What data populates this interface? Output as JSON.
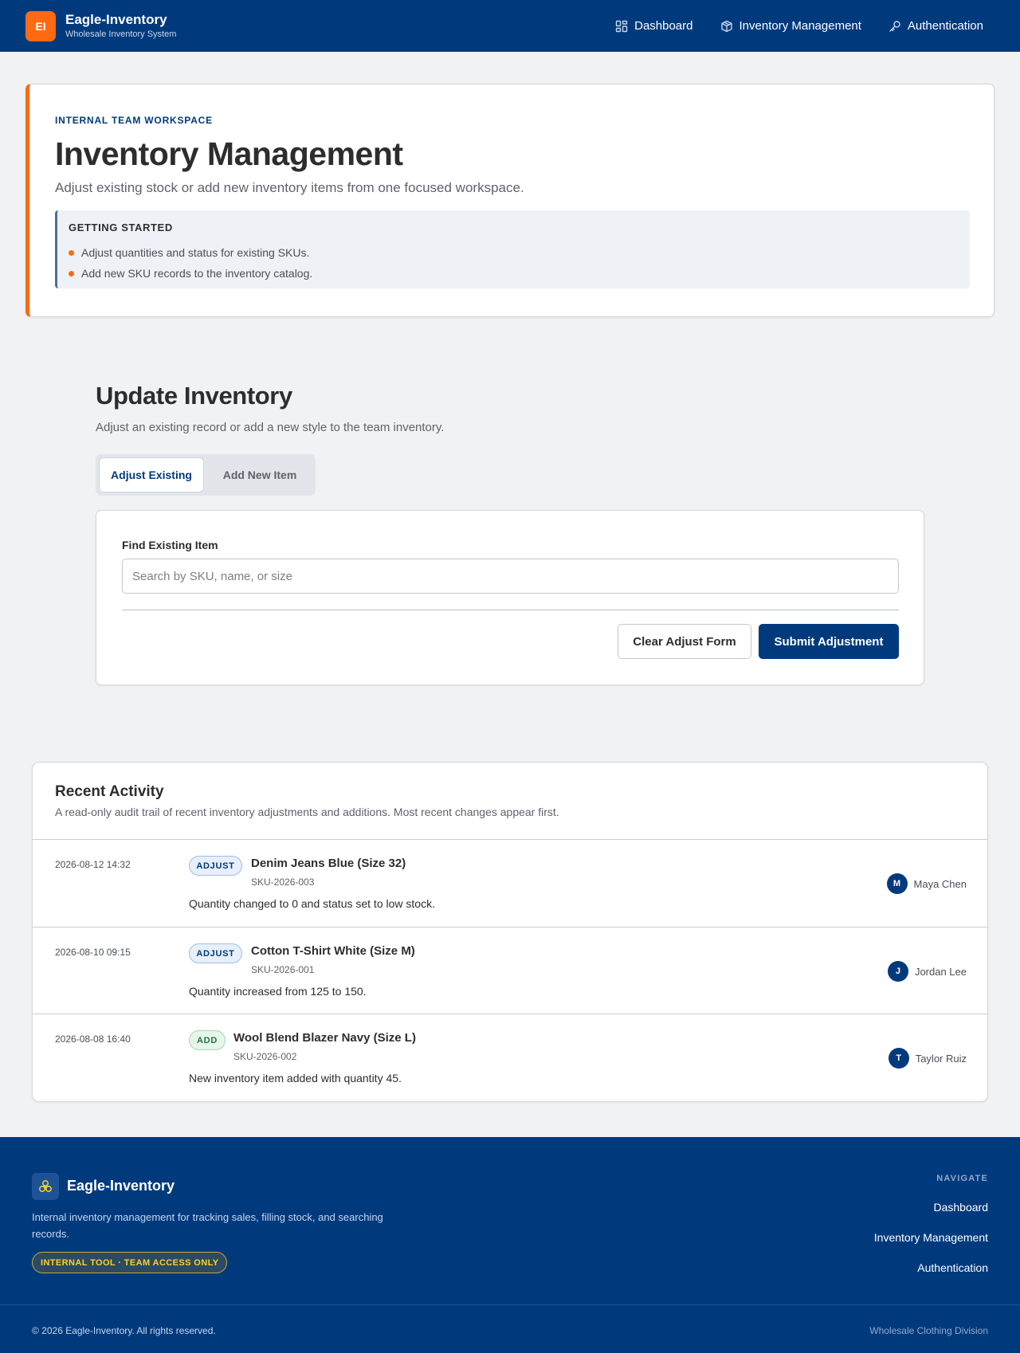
{
  "header": {
    "logo_initials": "EI",
    "brand_name": "Eagle-Inventory",
    "brand_subtitle": "Wholesale Inventory System",
    "nav": [
      {
        "label": "Dashboard",
        "icon": "dashboard-icon"
      },
      {
        "label": "Inventory Management",
        "icon": "package-icon"
      },
      {
        "label": "Authentication",
        "icon": "key-icon"
      }
    ]
  },
  "hero": {
    "eyebrow": "INTERNAL TEAM WORKSPACE",
    "title": "Inventory Management",
    "description": "Adjust existing stock or add new inventory items from one focused workspace.",
    "getting_started": {
      "title": "GETTING STARTED",
      "items": [
        "Adjust quantities and status for existing SKUs.",
        "Add new SKU records to the inventory catalog."
      ]
    }
  },
  "update": {
    "title": "Update Inventory",
    "description": "Adjust an existing record or add a new style to the team inventory.",
    "tabs": [
      {
        "label": "Adjust Existing",
        "active": true
      },
      {
        "label": "Add New Item",
        "active": false
      }
    ],
    "form": {
      "field_label": "Find Existing Item",
      "search_placeholder": "Search by SKU, name, or size",
      "search_value": "",
      "clear_label": "Clear Adjust Form",
      "submit_label": "Submit Adjustment"
    }
  },
  "activity": {
    "title": "Recent Activity",
    "description": "A read-only audit trail of recent inventory adjustments and additions. Most recent changes appear first.",
    "rows": [
      {
        "time": "2026-08-12 14:32",
        "type": "ADJUST",
        "name": "Denim Jeans Blue (Size 32)",
        "sku": "SKU-2026-003",
        "note": "Quantity changed to 0 and status set to low stock.",
        "user_initial": "M",
        "user": "Maya Chen"
      },
      {
        "time": "2026-08-10 09:15",
        "type": "ADJUST",
        "name": "Cotton T-Shirt White (Size M)",
        "sku": "SKU-2026-001",
        "note": "Quantity increased from 125 to 150.",
        "user_initial": "J",
        "user": "Jordan Lee"
      },
      {
        "time": "2026-08-08 16:40",
        "type": "ADD",
        "name": "Wool Blend Blazer Navy (Size L)",
        "sku": "SKU-2026-002",
        "note": "New inventory item added with quantity 45.",
        "user_initial": "T",
        "user": "Taylor Ruiz"
      }
    ]
  },
  "footer": {
    "logo_icon": "eagle-logo-icon",
    "brand_name": "Eagle-Inventory",
    "description": "Internal inventory management for tracking sales, filling stock, and searching records.",
    "badge": "INTERNAL TOOL · TEAM ACCESS ONLY",
    "nav_title": "NAVIGATE",
    "links": [
      "Dashboard",
      "Inventory Management",
      "Authentication"
    ],
    "copyright": "© 2026 Eagle-Inventory. All rights reserved.",
    "division": "Wholesale Clothing Division"
  },
  "colors": {
    "primary": "#003a7d",
    "accent": "#ff6a13",
    "background": "#f1f2f4",
    "footer_badge": "#ffd12a"
  }
}
